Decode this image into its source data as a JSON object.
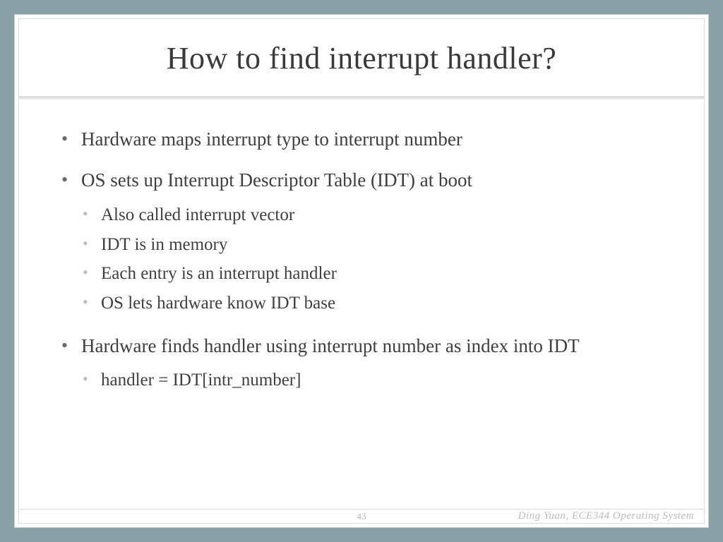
{
  "title": "How to find interrupt handler?",
  "bullets": {
    "b1": "Hardware maps interrupt type to interrupt number",
    "b2": "OS sets up Interrupt Descriptor Table (IDT) at boot",
    "b2s1": "Also called interrupt vector",
    "b2s2": "IDT is in memory",
    "b2s3": "Each entry is an interrupt handler",
    "b2s4": "OS lets hardware know IDT base",
    "b3": "Hardware finds handler using interrupt number as index into IDT",
    "b3s1": "handler = IDT[intr_number]"
  },
  "footer": {
    "page": "43",
    "credit": "Ding Yuan, ECE344 Operating System"
  }
}
